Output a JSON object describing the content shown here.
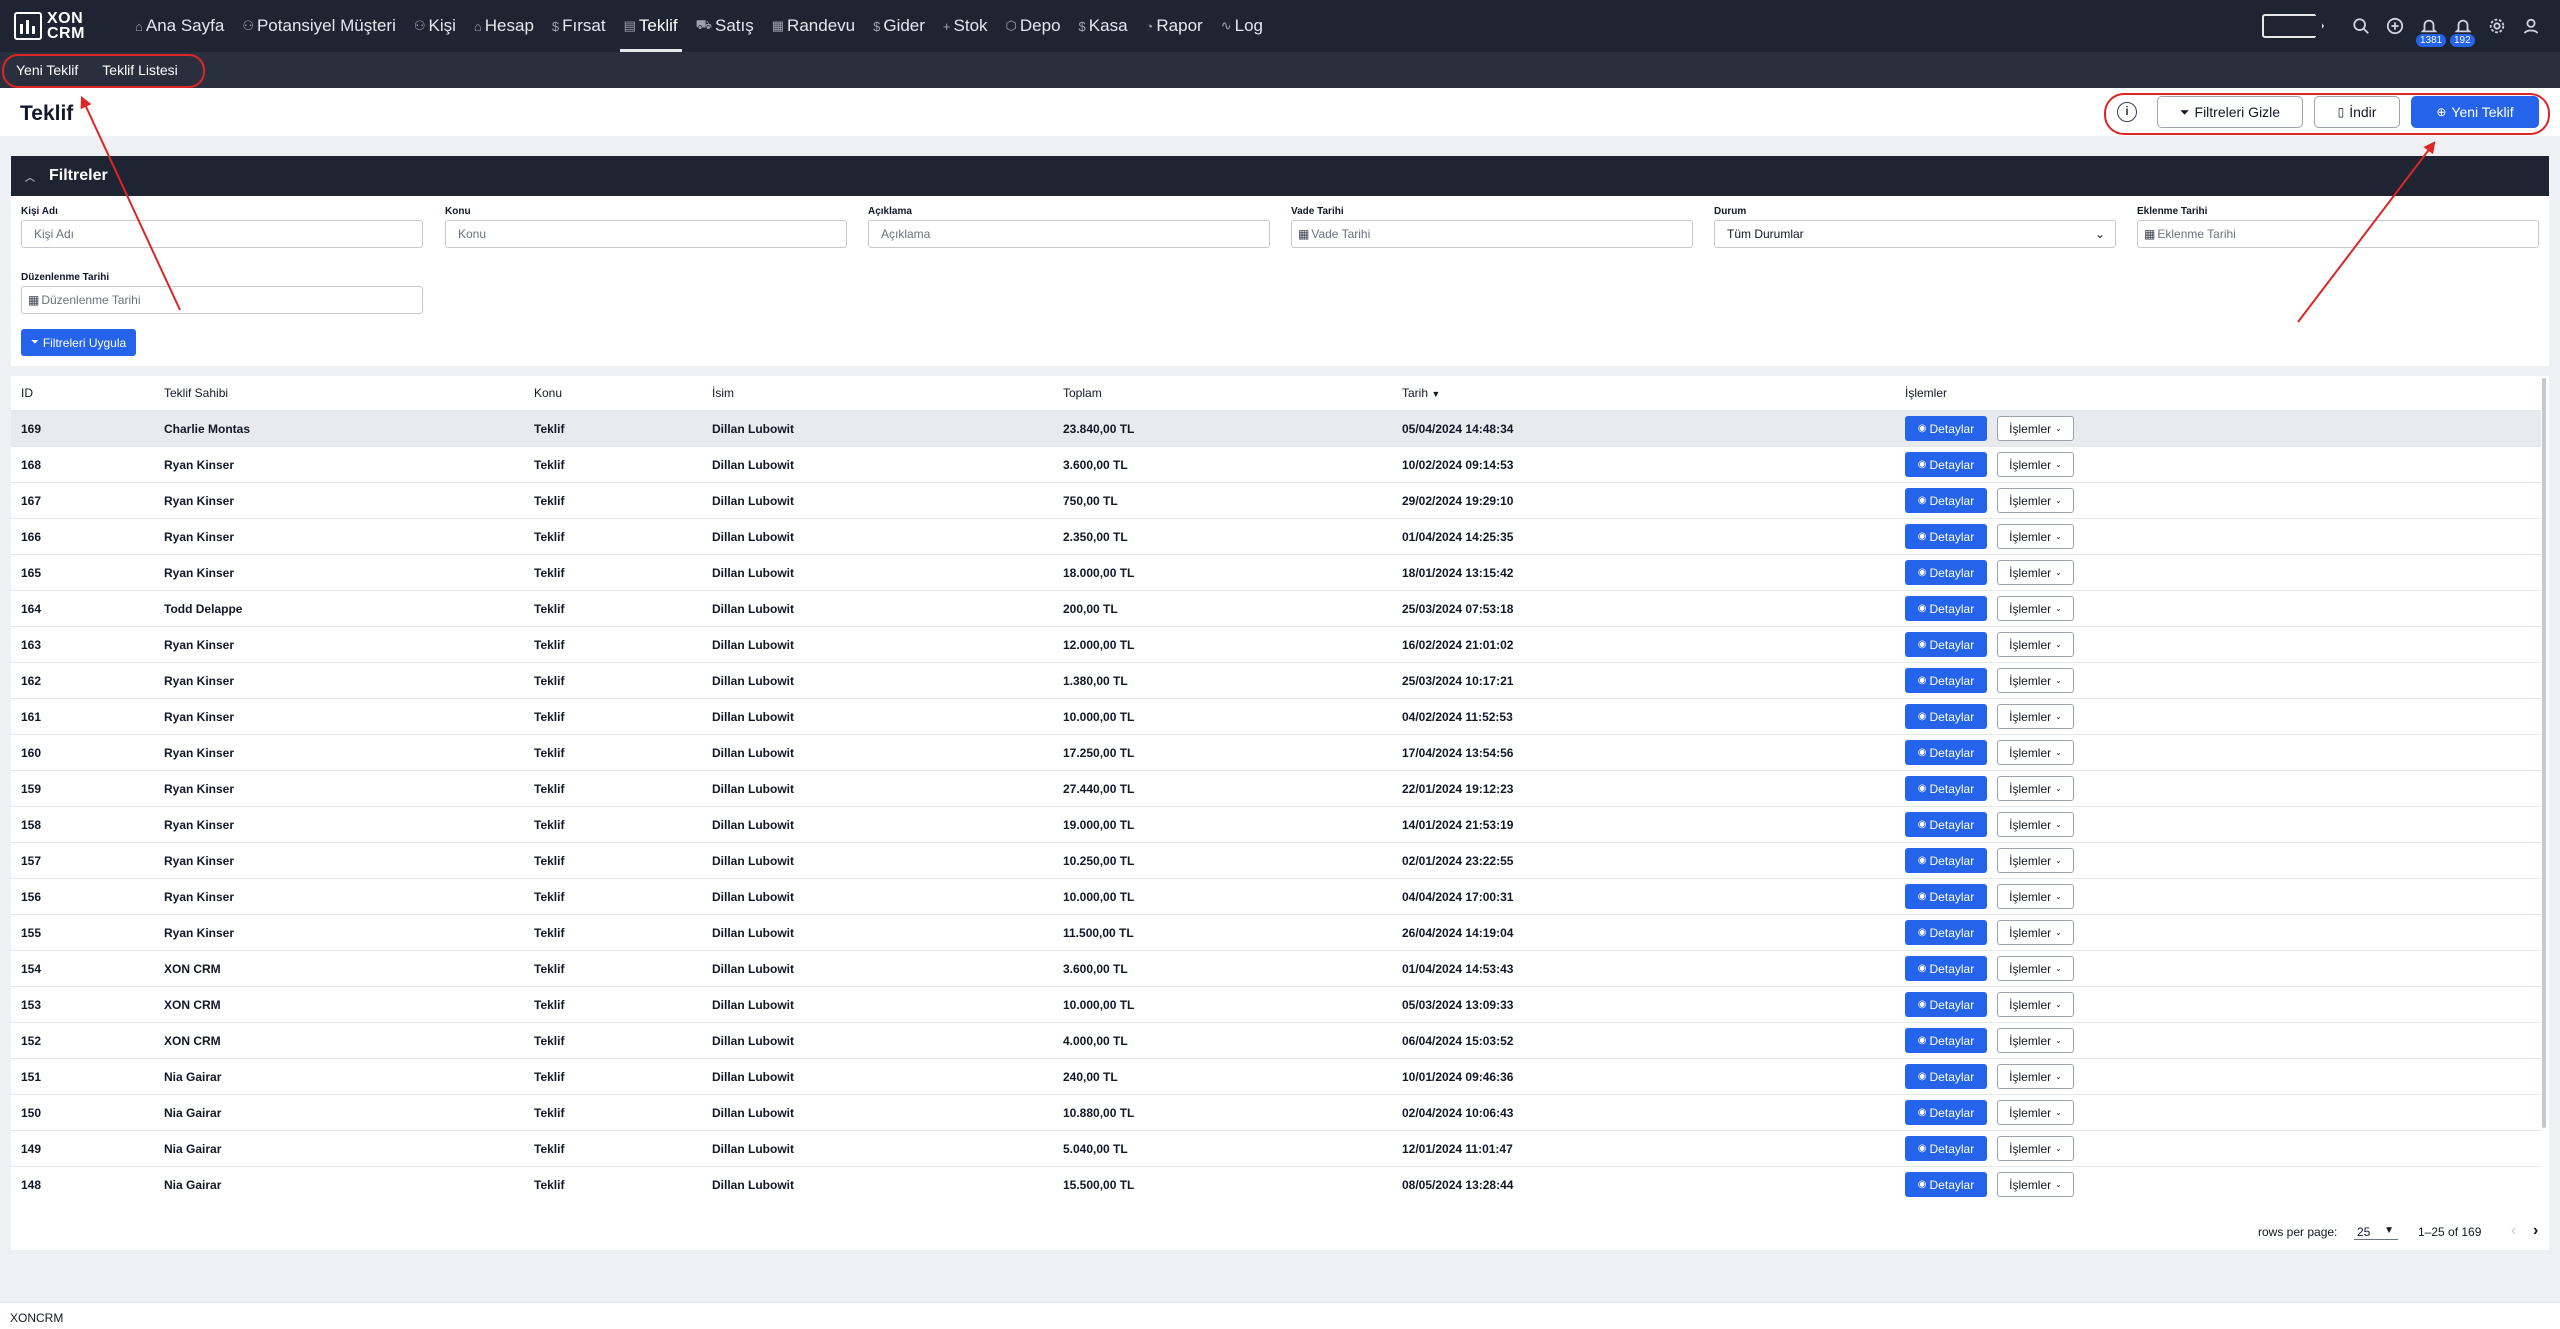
{
  "app": {
    "logo_line1": "XON",
    "logo_line2": "CRM"
  },
  "nav": {
    "items": [
      {
        "icon": "⌂",
        "label": "Ana Sayfa",
        "active": false
      },
      {
        "icon": "⚇",
        "label": "Potansiyel Müşteri",
        "active": false
      },
      {
        "icon": "⚇",
        "label": "Kişi",
        "active": false
      },
      {
        "icon": "⌂",
        "label": "Hesap",
        "active": false
      },
      {
        "icon": "$",
        "label": "Fırsat",
        "active": false
      },
      {
        "icon": "▤",
        "label": "Teklif",
        "active": true
      },
      {
        "icon": "⛟",
        "label": "Satış",
        "active": false
      },
      {
        "icon": "▦",
        "label": "Randevu",
        "active": false
      },
      {
        "icon": "$",
        "label": "Gider",
        "active": false
      },
      {
        "icon": "+",
        "label": "Stok",
        "active": false
      },
      {
        "icon": "⬡",
        "label": "Depo",
        "active": false
      },
      {
        "icon": "$",
        "label": "Kasa",
        "active": false
      },
      {
        "icon": "◔",
        "label": "Rapor",
        "active": false
      },
      {
        "icon": "∿",
        "label": "Log",
        "active": false
      }
    ],
    "badge_notifications": "1381",
    "badge_alerts": "192"
  },
  "subnav": {
    "new_quote": "Yeni Teklif",
    "quote_list": "Teklif Listesi"
  },
  "header": {
    "title": "Teklif",
    "info": "i",
    "hide_filters": "Filtreleri Gizle",
    "download": "İndir",
    "new_quote": "Yeni Teklif"
  },
  "filters": {
    "title": "Filtreler",
    "person_label": "Kişi Adı",
    "person_placeholder": "Kişi Adı",
    "subject_label": "Konu",
    "subject_placeholder": "Konu",
    "desc_label": "Açıklama",
    "desc_placeholder": "Açıklama",
    "due_label": "Vade Tarihi",
    "due_placeholder": "Vade Tarihi",
    "status_label": "Durum",
    "status_value": "Tüm Durumlar",
    "added_label": "Eklenme Tarihi",
    "added_placeholder": "Eklenme Tarihi",
    "edited_label": "Düzenlenme Tarihi",
    "edited_placeholder": "Düzenlenme Tarihi",
    "apply": "Filtreleri Uygula"
  },
  "table": {
    "headers": {
      "id": "ID",
      "owner": "Teklif Sahibi",
      "subject": "Konu",
      "name": "İsim",
      "total": "Toplam",
      "date": "Tarih",
      "actions": "İşlemler"
    },
    "details_label": "Detaylar",
    "ops_label": "İşlemler",
    "rows": [
      [
        "169",
        "Charlie Montas",
        "Teklif",
        "Dillan Lubowit",
        "23.840,00 TL",
        "05/04/2024 14:48:34"
      ],
      [
        "168",
        "Ryan Kinser",
        "Teklif",
        "Dillan Lubowit",
        "3.600,00 TL",
        "10/02/2024 09:14:53"
      ],
      [
        "167",
        "Ryan Kinser",
        "Teklif",
        "Dillan Lubowit",
        "750,00 TL",
        "29/02/2024 19:29:10"
      ],
      [
        "166",
        "Ryan Kinser",
        "Teklif",
        "Dillan Lubowit",
        "2.350,00 TL",
        "01/04/2024 14:25:35"
      ],
      [
        "165",
        "Ryan Kinser",
        "Teklif",
        "Dillan Lubowit",
        "18.000,00 TL",
        "18/01/2024 13:15:42"
      ],
      [
        "164",
        "Todd Delappe",
        "Teklif",
        "Dillan Lubowit",
        "200,00 TL",
        "25/03/2024 07:53:18"
      ],
      [
        "163",
        "Ryan Kinser",
        "Teklif",
        "Dillan Lubowit",
        "12.000,00 TL",
        "16/02/2024 21:01:02"
      ],
      [
        "162",
        "Ryan Kinser",
        "Teklif",
        "Dillan Lubowit",
        "1.380,00 TL",
        "25/03/2024 10:17:21"
      ],
      [
        "161",
        "Ryan Kinser",
        "Teklif",
        "Dillan Lubowit",
        "10.000,00 TL",
        "04/02/2024 11:52:53"
      ],
      [
        "160",
        "Ryan Kinser",
        "Teklif",
        "Dillan Lubowit",
        "17.250,00 TL",
        "17/04/2024 13:54:56"
      ],
      [
        "159",
        "Ryan Kinser",
        "Teklif",
        "Dillan Lubowit",
        "27.440,00 TL",
        "22/01/2024 19:12:23"
      ],
      [
        "158",
        "Ryan Kinser",
        "Teklif",
        "Dillan Lubowit",
        "19.000,00 TL",
        "14/01/2024 21:53:19"
      ],
      [
        "157",
        "Ryan Kinser",
        "Teklif",
        "Dillan Lubowit",
        "10.250,00 TL",
        "02/01/2024 23:22:55"
      ],
      [
        "156",
        "Ryan Kinser",
        "Teklif",
        "Dillan Lubowit",
        "10.000,00 TL",
        "04/04/2024 17:00:31"
      ],
      [
        "155",
        "Ryan Kinser",
        "Teklif",
        "Dillan Lubowit",
        "11.500,00 TL",
        "26/04/2024 14:19:04"
      ],
      [
        "154",
        "XON CRM",
        "Teklif",
        "Dillan Lubowit",
        "3.600,00 TL",
        "01/04/2024 14:53:43"
      ],
      [
        "153",
        "XON CRM",
        "Teklif",
        "Dillan Lubowit",
        "10.000,00 TL",
        "05/03/2024 13:09:33"
      ],
      [
        "152",
        "XON CRM",
        "Teklif",
        "Dillan Lubowit",
        "4.000,00 TL",
        "06/04/2024 15:03:52"
      ],
      [
        "151",
        "Nia Gairar",
        "Teklif",
        "Dillan Lubowit",
        "240,00 TL",
        "10/01/2024 09:46:36"
      ],
      [
        "150",
        "Nia Gairar",
        "Teklif",
        "Dillan Lubowit",
        "10.880,00 TL",
        "02/04/2024 10:06:43"
      ],
      [
        "149",
        "Nia Gairar",
        "Teklif",
        "Dillan Lubowit",
        "5.040,00 TL",
        "12/01/2024 11:01:47"
      ],
      [
        "148",
        "Nia Gairar",
        "Teklif",
        "Dillan Lubowit",
        "15.500,00 TL",
        "08/05/2024 13:28:44"
      ]
    ]
  },
  "pager": {
    "label": "rows per page:",
    "size": "25",
    "range": "1–25 of 169"
  },
  "footer": {
    "text": "XONCRM"
  },
  "colors": {
    "navbar": "#1f2433",
    "primary": "#2563eb",
    "annotation": "#dc2626"
  }
}
